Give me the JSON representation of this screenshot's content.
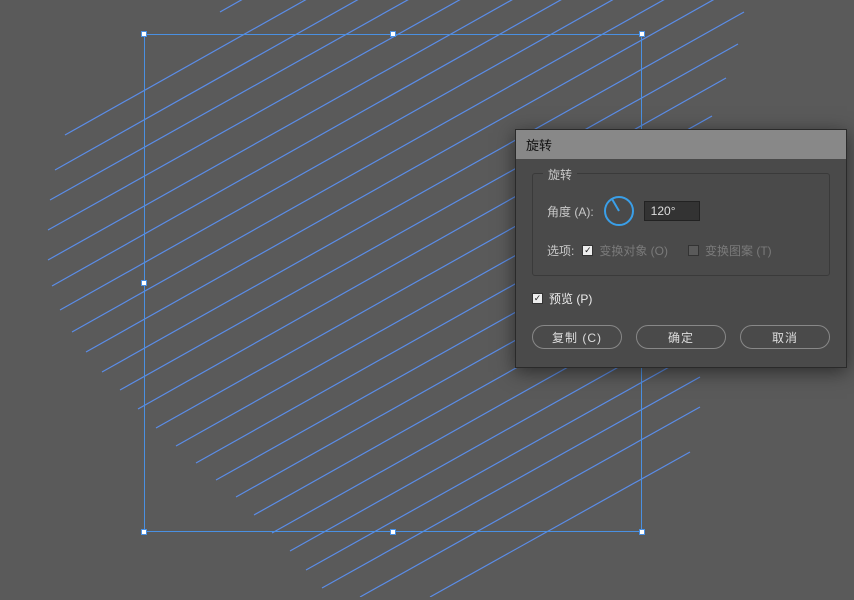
{
  "dialog": {
    "title": "旋转",
    "section_title": "旋转",
    "angle_label": "角度 (A):",
    "angle_value": "120°",
    "options_label": "选项:",
    "transform_objects": "变换对象 (O)",
    "transform_patterns": "变换图案 (T)",
    "transform_objects_checked": true,
    "transform_patterns_checked": false,
    "preview_label": "预览 (P)",
    "preview_checked": true,
    "copy_btn": "复制 (C)",
    "ok_btn": "确定",
    "cancel_btn": "取消"
  }
}
